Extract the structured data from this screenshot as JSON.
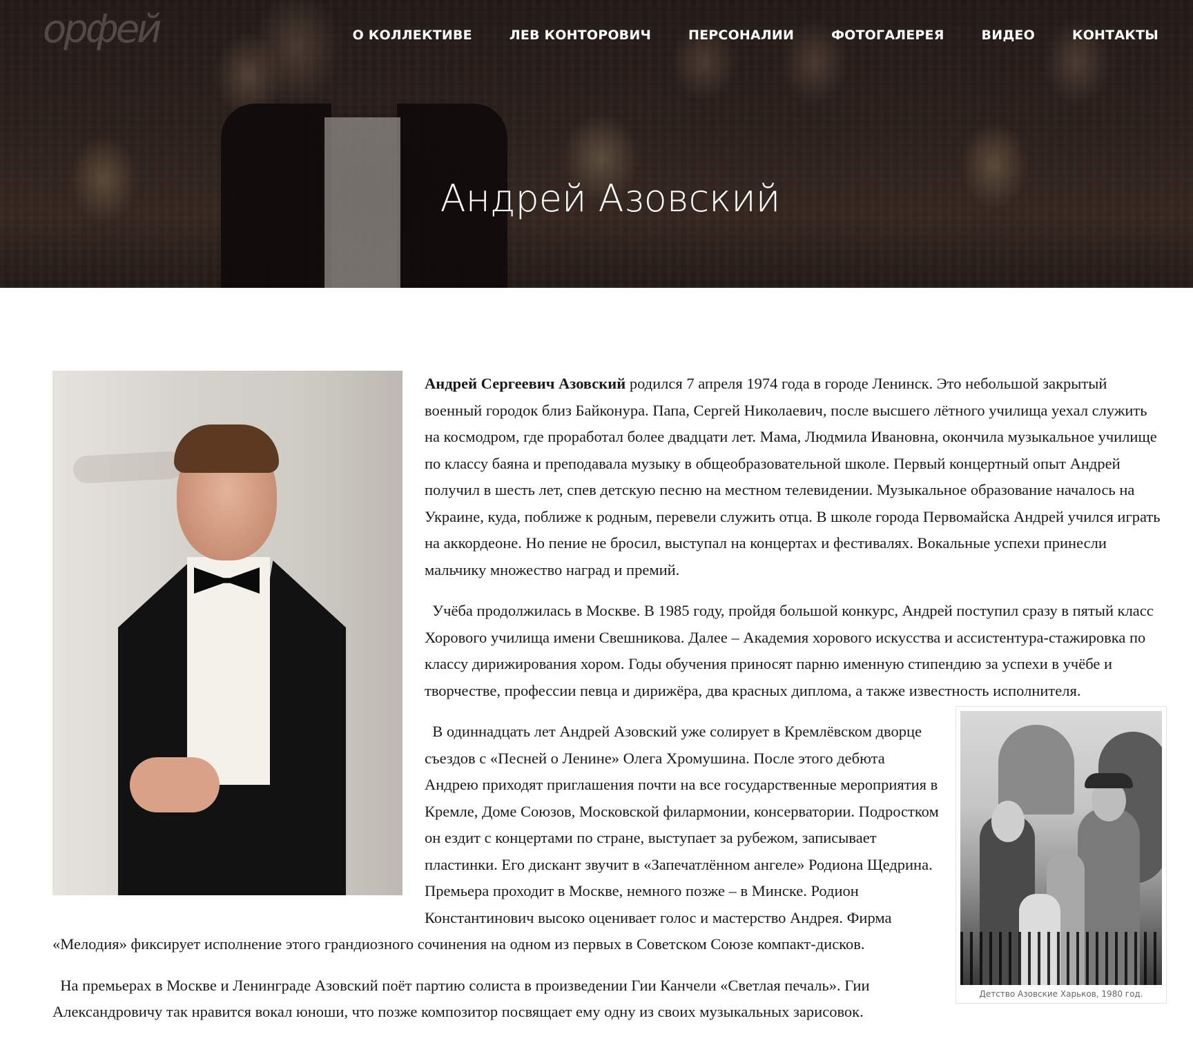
{
  "site": {
    "logo_text": "орфей",
    "nav": [
      "О КОЛЛЕКТИВЕ",
      "ЛЕВ КОНТОРОВИЧ",
      "ПЕРСОНАЛИИ",
      "ФОТОГАЛЕРЕЯ",
      "ВИДЕО",
      "КОНТАКТЫ"
    ]
  },
  "hero": {
    "title": "Андрей Азовский"
  },
  "article": {
    "p1_bold": "Андрей Сергеевич Азовский",
    "p1_rest": " родился 7 апреля 1974 года в городе Ленинск. Это небольшой закрытый военный городок близ Байконура. Папа, Сергей Николаевич, после высшего лётного училища уехал служить на космодром, где проработал более двадцати лет. Мама, Людмила Ивановна, окончила музыкальное училище по классу баяна и преподавала музыку в общеобразовательной школе. Первый концертный опыт Андрей получил в шесть лет, спев детскую песню на местном телевидении. Музыкальное образование началось на Украине, куда, поближе к родным, перевели служить отца. В школе города Первомайска Андрей учился играть на аккордеоне. Но пение не бросил, выступал на концертах и фестивалях. Вокальные успехи принесли мальчику множество наград и премий.",
    "p2": "  Учёба продолжилась в Москве. В 1985 году, пройдя большой конкурс, Андрей поступил сразу в пятый класс Хорового училища имени Свешникова. Далее – Академия хорового искусства и ассистентура-стажировка по классу дирижирования хором. Годы обучения приносят парню именную стипендию за успехи в учёбе и творчестве, профессии певца и дирижёра, два красных диплома, а также известность исполнителя.",
    "p3": "  В одиннадцать лет Андрей Азовский уже солирует в Кремлёвском дворце съездов с «Песней о Ленине» Олега Хромушина. После этого дебюта Андрею приходят приглашения почти на все государственные мероприятия в Кремле, Доме Союзов, Московской филармонии, консерватории. Подростком он ездит с концертами по стране, выступает за рубежом, записывает пластинки. Его дискант звучит в «Запечатлённом ангеле» Родиона Щедрина. Премьера проходит в Москве, немного позже – в Минске. Родион Константинович высоко оценивает голос и мастерство Андрея. Фирма «Мелодия» фиксирует исполнение этого грандиозного сочинения на одном из первых в Советском Союзе компакт-дисков.",
    "p4": "  На премьерах в Москве и Ленинграде Азовский поёт партию солиста в произведении Гии Канчели «Светлая печаль». Гии Александровичу так нравится вокал юноши, что позже композитор посвящает ему одну из своих музыкальных зарисовок.",
    "family_caption": "Детство Азовские Харьков, 1980 год."
  }
}
